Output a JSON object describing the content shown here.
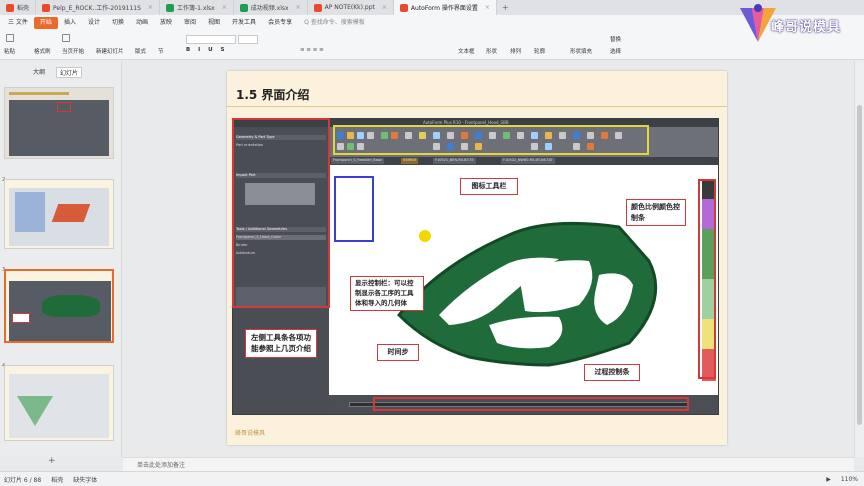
{
  "tabs": [
    {
      "label": "稻壳",
      "color": "#ea4b2c",
      "active": false
    },
    {
      "label": "Pelp_E_ROCK..工作-2019111S",
      "color": "#ea4b2c",
      "active": false
    },
    {
      "label": "工作簿-1.xlsx",
      "color": "#1f9d55",
      "active": false
    },
    {
      "label": "成功视频.xlsx",
      "color": "#1f9d55",
      "active": false
    },
    {
      "label": "AP NOTE(Kk).ppt",
      "color": "#ea4b2c",
      "active": false
    },
    {
      "label": "AutoForm 操作界面设置",
      "color": "#ea4b2c",
      "active": true
    }
  ],
  "menu": {
    "items": [
      "三 文件",
      "开始",
      "插入",
      "设计",
      "切换",
      "动画",
      "放映",
      "审阅",
      "视图",
      "开发工具",
      "会员专享",
      "Q 查找命令、搜索模板"
    ],
    "active_index": 1
  },
  "ribbon": {
    "paste": "粘贴",
    "format_painter": "格式刷",
    "new_slide": "新建幻灯片",
    "layout": "版式",
    "from_start": "当页开始",
    "reset": "重置",
    "section": "节",
    "text_box": "文本框",
    "shapes": "形状",
    "arrange": "排列",
    "outline": "轮廓",
    "replace": "替换",
    "select": "选择",
    "shape_fill": "形状填充"
  },
  "logo": {
    "text": "峰哥说模具"
  },
  "left_panel": {
    "tab_outline": "大纲",
    "tab_slides": "幻灯片",
    "slide_numbers": [
      "",
      "2",
      "3",
      "4",
      "5"
    ]
  },
  "slide": {
    "title": "1.5 界面介绍",
    "footer": "峰哥说模具"
  },
  "app": {
    "title": "AutoForm Plus R10 - Frontpanel_Hood_SBB",
    "view_tabs": [
      "Frontpanel_S_Feasible_Base",
      "SSIM00",
      "F10521_BEN-RS-BT-TE",
      "F10522_NW60-RS-BT-NE-TAT"
    ],
    "left_rows": [
      "Geometry & Part Type",
      "Part orientation",
      "Import Part",
      "Tools / Additional Geometries",
      "Frontpanel_S_Hood_Outer",
      "Binder",
      "Addendum"
    ]
  },
  "callouts": {
    "toolbar": "图标工具栏",
    "colorbar": "颜色比例颜色控制条",
    "display": "显示控制栏：可以控制显示各工序的工具体和导入的几何体",
    "leftbar": "左侧工具条各项功能参照上几页介绍",
    "timestep": "时间步",
    "process": "过程控制条"
  },
  "notes": "单击此处添加备注",
  "status": {
    "slide_info": "幻灯片 6 / 88",
    "theme": "稻壳",
    "missing_font": "缺失字体",
    "zoom": "110%"
  },
  "colors": {
    "accent": "#ea6a2c",
    "annotation_red": "#d23a3a",
    "annotation_yellow": "#e4d63a",
    "annotation_blue": "#3a3ed2",
    "part_green": "#1f6b3a"
  }
}
